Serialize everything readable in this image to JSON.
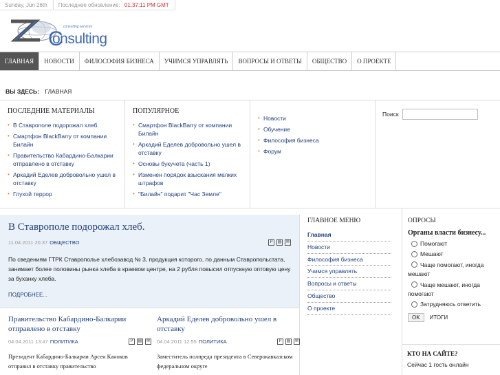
{
  "topbar": {
    "date": "Sunday, Jun 26th",
    "updated_label": "Последнее обновление:",
    "updated_time": "01:37:11 PM GMT"
  },
  "logo": {
    "tagline": "consulting services",
    "word": "onsulting"
  },
  "nav": {
    "items": [
      "Главная",
      "Новости",
      "Философия бизнеса",
      "Учимся управлять",
      "Вопросы и ответы",
      "Общество",
      "О проекте"
    ]
  },
  "breadcrumb": {
    "label": "ВЫ ЗДЕСЬ:",
    "current": "ГЛАВНАЯ"
  },
  "latest": {
    "title": "Последние материалы",
    "items": [
      "В Ставрополе подорожал хлеб.",
      "Смартфон BlackBarry от компании Билайн",
      "Правительство Кабардино-Балкарии отправлено в отставку",
      "Аркадий Еделев добровольно ушел в отставку",
      "Глухой террор"
    ]
  },
  "popular": {
    "title": "Популярное",
    "items": [
      "Смартфон BlackBarry от компании Билайн",
      "Аркадий Еделев добровольно ушел в отставку",
      "Основы букучета (часть 1)",
      "Изменен порядок взыскания мелких штрафов",
      "\"Билайн\" подарит \"Час Земле\""
    ]
  },
  "links": {
    "items": [
      "Новости",
      "Обучение",
      "Философия бизнеса",
      "Форум"
    ]
  },
  "search": {
    "label": "Поиск",
    "placeholder": ""
  },
  "lead": {
    "title": "В Ставрополе подорожал хлеб.",
    "date": "11.04.2011 20:37",
    "category": "Общество",
    "text": "По сведениям ГТРК Ставрополье хлебозавод № 3, продукция которого, по данным Ставропольстата, занимает более половины рынка хлеба в краевом центре, на 2 рубля повысил отпускную оптовую цену за буханку хлеба.",
    "more": "Подробнее..."
  },
  "articles": [
    {
      "title": "Правительство Кабардино-Балкарии отправлено в отставку",
      "date": "04.04.2011 13:47",
      "category": "Политика",
      "text": "Президент Кабардино-Балкарии Арсен Каноков отправил в отставку правительство"
    },
    {
      "title": "Аркадий Еделев добровольно ушел в отставку",
      "date": "04.04.2011 12:55",
      "category": "Политика",
      "text": "Заместитель полпреда президента в Северокавказском федеральном округе"
    }
  ],
  "menu": {
    "title": "Главное меню",
    "items": [
      "Главная",
      "Новости",
      "Философия бизнеса",
      "Учимся управлять",
      "Вопросы и ответы",
      "Общество",
      "О проекте"
    ]
  },
  "poll": {
    "title": "Опросы",
    "question": "Органы власти бизнесу...",
    "options": [
      "Помогают",
      "Мешают",
      "Чаще помогают, иногда мешают",
      "Чаще мешают, иногда помогают",
      "Затрудняюсь ответить"
    ],
    "ok": "OK",
    "results": "Итоги"
  },
  "who": {
    "title": "Кто на сайте?",
    "text": "Сейчас 1 гость онлайн"
  }
}
